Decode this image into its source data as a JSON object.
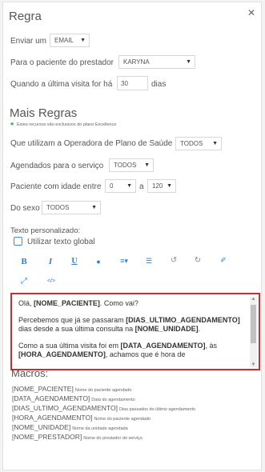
{
  "rule": {
    "title": "Regra",
    "send_label": "Enviar um",
    "send_value": "EMAIL",
    "patient_provider_label": "Para o paciente do prestador",
    "provider_value": "KARYNA",
    "last_visit_label": "Quando a última visita for há",
    "last_visit_days": "30",
    "days_label": "dias"
  },
  "more_rules": {
    "title": "Mais Regras",
    "excellence_note": "Estes recursos são exclusivos do plano Excellence",
    "health_plan_label": "Que utilizam a Operadora de Plano de Saúde",
    "health_plan_value": "TODOS",
    "scheduled_service_label": "Agendados para o serviço",
    "scheduled_service_value": "TODOS",
    "age_label": "Paciente com idade entre",
    "age_from": "0",
    "age_and": "a",
    "age_to": "120",
    "sex_label": "Do sexo",
    "sex_value": "TODOS"
  },
  "custom_text": {
    "label": "Texto personalizado:",
    "global_label": "Utilizar texto global"
  },
  "toolbar": {
    "bold": "B",
    "italic": "I",
    "underline": "U",
    "color": "●",
    "align": "≡▾",
    "list": "☰",
    "undo": "↺",
    "redo": "↻",
    "eraser": "✐",
    "fullscreen": "⤢",
    "code": "</>"
  },
  "editor": {
    "p1_a": "Olá, ",
    "p1_b": "[NOME_PACIENTE]",
    "p1_c": ". Como vai?",
    "p2_a": "Percebemos que já se passaram ",
    "p2_b": "[DIAS_ULTIMO_AGENDAMENTO]",
    "p2_c": " dias desde a sua última consulta na ",
    "p2_d": "[NOME_UNIDADE]",
    "p2_e": ".",
    "p3_a": "Como a sua última visita foi em ",
    "p3_b": "[DATA_AGENDAMENTO]",
    "p3_c": ", às ",
    "p3_d": "[HORA_AGENDAMENTO]",
    "p3_e": ", achamos que é hora de"
  },
  "macros": {
    "title": "Macros:",
    "items": [
      {
        "code": "[NOME_PACIENTE]",
        "desc": "Nome do paciente agendado"
      },
      {
        "code": "[DATA_AGENDAMENTO]",
        "desc": "Data do agendamento"
      },
      {
        "code": "[DIAS_ULTIMO_AGENDAMENTO]",
        "desc": "Dias passados do último agendamento"
      },
      {
        "code": "[HORA_AGENDAMENTO]",
        "desc": "Nome do paciente agendado"
      },
      {
        "code": "[NOME_UNIDADE]",
        "desc": "Nome da unidade agendada"
      },
      {
        "code": "[NOME_PRESTADOR]",
        "desc": "Nome do prestador do serviço"
      }
    ]
  },
  "colors": {
    "accent": "#2f7fce",
    "highlight_border": "#d9262b",
    "star": "#3aa655"
  },
  "icons": {
    "close": "close-icon",
    "star": "star-icon",
    "caret": "chevron-down-icon"
  }
}
